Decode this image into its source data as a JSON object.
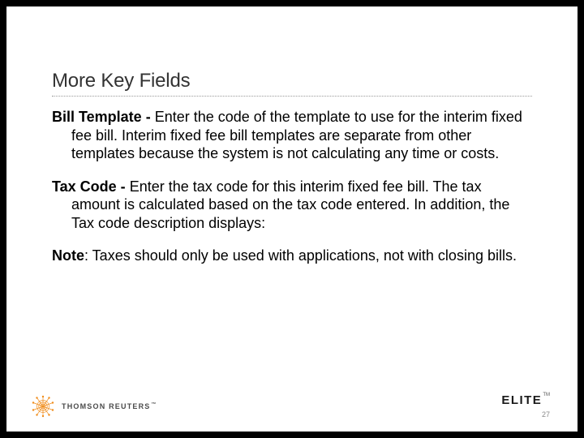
{
  "slide": {
    "title": "More Key Fields",
    "paragraphs": [
      {
        "term": "Bill Template - ",
        "body": "Enter the code of the template to use for the interim fixed fee bill. Interim fixed fee bill templates are separate from other templates because the system is not calculating any time or costs."
      },
      {
        "term": "Tax Code - ",
        "body": "Enter the tax code for this interim fixed fee bill.  The tax amount is calculated based on the tax code entered. In addition, the Tax code description displays:"
      },
      {
        "term": "Note",
        "body": ": Taxes should only be used with applications, not with closing bills."
      }
    ]
  },
  "footer": {
    "tr_brand": "THOMSON REUTERS",
    "tr_tm": "™",
    "elite_brand": "ELITE",
    "elite_tm": "TM",
    "page_number": "27"
  },
  "colors": {
    "tr_orange": "#f08c1a"
  }
}
